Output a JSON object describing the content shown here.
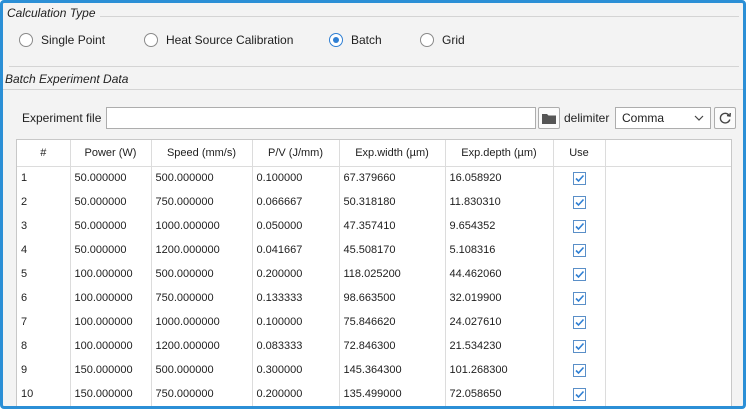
{
  "calc_type": {
    "title": "Calculation Type",
    "options": [
      {
        "label": "Single Point",
        "checked": false
      },
      {
        "label": "Heat Source Calibration",
        "checked": false
      },
      {
        "label": "Batch",
        "checked": true
      },
      {
        "label": "Grid",
        "checked": false
      }
    ]
  },
  "batch": {
    "title": "Batch Experiment Data",
    "file_label": "Experiment file",
    "file_value": "",
    "folder_icon": "folder-icon",
    "delimiter_label": "delimiter",
    "delimiter_value": "Comma",
    "refresh_icon": "refresh-icon"
  },
  "table": {
    "columns": [
      "#",
      "Power (W)",
      "Speed (mm/s)",
      "P/V (J/mm)",
      "Exp.width (µm)",
      "Exp.depth (µm)",
      "Use"
    ],
    "rows": [
      [
        "1",
        "50.000000",
        "500.000000",
        "0.100000",
        "67.379660",
        "16.058920",
        true
      ],
      [
        "2",
        "50.000000",
        "750.000000",
        "0.066667",
        "50.318180",
        "11.830310",
        true
      ],
      [
        "3",
        "50.000000",
        "1000.000000",
        "0.050000",
        "47.357410",
        "9.654352",
        true
      ],
      [
        "4",
        "50.000000",
        "1200.000000",
        "0.041667",
        "45.508170",
        "5.108316",
        true
      ],
      [
        "5",
        "100.000000",
        "500.000000",
        "0.200000",
        "118.025200",
        "44.462060",
        true
      ],
      [
        "6",
        "100.000000",
        "750.000000",
        "0.133333",
        "98.663500",
        "32.019900",
        true
      ],
      [
        "7",
        "100.000000",
        "1000.000000",
        "0.100000",
        "75.846620",
        "24.027610",
        true
      ],
      [
        "8",
        "100.000000",
        "1200.000000",
        "0.083333",
        "72.846300",
        "21.534230",
        true
      ],
      [
        "9",
        "150.000000",
        "500.000000",
        "0.300000",
        "145.364300",
        "101.268300",
        true
      ],
      [
        "10",
        "150.000000",
        "750.000000",
        "0.200000",
        "135.499000",
        "72.058650",
        true
      ]
    ]
  },
  "colors": {
    "accent": "#2f7fd3",
    "frame_border": "#2b8fd6",
    "background": "#f3f3f3"
  }
}
